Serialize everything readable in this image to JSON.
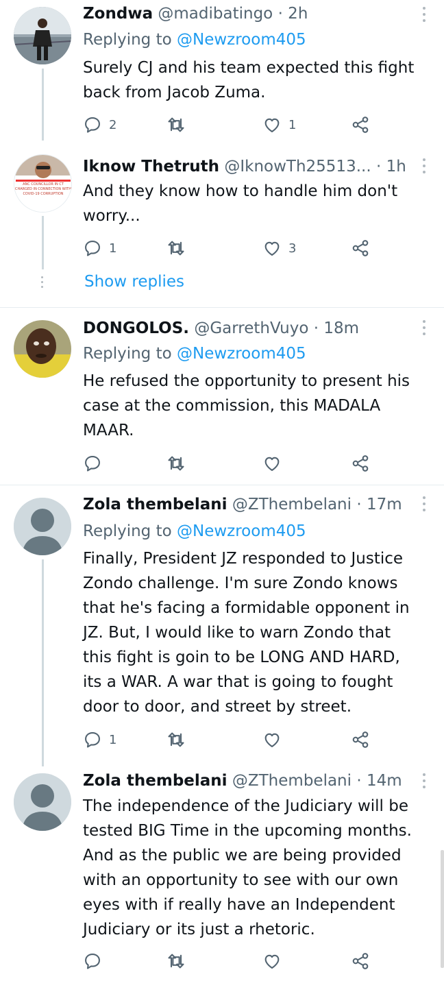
{
  "tweets": [
    {
      "name": "Zondwa",
      "handle": "@madibatingo",
      "time": "· 2h",
      "replying_prefix": "Replying to",
      "replying_to": "@Newzroom405",
      "text": "Surely CJ and his team expected this fight\nback from Jacob Zuma.",
      "replies": "2",
      "retweets": "",
      "likes": "1"
    },
    {
      "name": "Iknow Thetruth",
      "handle": "@IknowTh25513...",
      "time": "· 1h",
      "text": "And they know how to handle him don't\nworry...",
      "replies": "1",
      "retweets": "",
      "likes": "3",
      "avatar_text": [
        "ANC COUNCILLOR IN CT",
        "CHARGED IN CONNECTION WITH",
        "COVID-19 CORRUPTION"
      ]
    },
    {
      "name": "DONGOLOS.",
      "handle": "@GarrethVuyo",
      "time": "· 18m",
      "replying_prefix": "Replying to",
      "replying_to": "@Newzroom405",
      "text": "He refused the opportunity to present his\ncase at the commission, this MADALA\nMAAR.",
      "replies": "",
      "retweets": "",
      "likes": ""
    },
    {
      "name": "Zola thembelani",
      "handle": "@ZThembelani",
      "time": "· 17m",
      "replying_prefix": "Replying to",
      "replying_to": "@Newzroom405",
      "text": "Finally, President JZ responded to Justice\nZondo challenge. I'm sure Zondo knows\nthat he's facing a formidable opponent in\nJZ. But, I would like to warn Zondo that\nthis fight is goin to be LONG AND HARD,\nits a WAR. A war that is going to fought\ndoor to door, and street by street.",
      "replies": "1",
      "retweets": "",
      "likes": ""
    },
    {
      "name": "Zola thembelani",
      "handle": "@ZThembelani",
      "time": "· 14m",
      "text": "The independence of the Judiciary will be\ntested BIG Time in the upcoming months.\nAnd as the public we are being provided\nwith an opportunity to see with our own\neyes with if really have an Independent\nJudiciary or its just a rhetoric.",
      "replies": "",
      "retweets": "",
      "likes": ""
    }
  ],
  "show_replies": "Show replies",
  "colors": {
    "link": "#1d9bf0",
    "muted": "#536471",
    "text": "#0f1419",
    "thread_line": "#cfd9de"
  },
  "icons": [
    "reply-icon",
    "retweet-icon",
    "like-icon",
    "share-icon",
    "more-icon"
  ]
}
